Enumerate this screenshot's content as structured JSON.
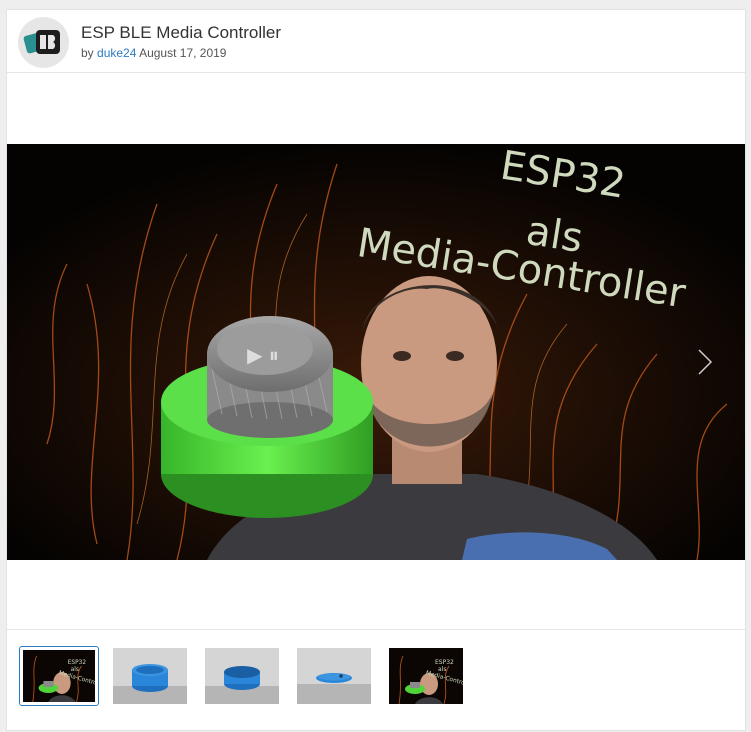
{
  "header": {
    "title": "ESP BLE Media Controller",
    "by_label": "by",
    "author": "duke24",
    "date": "August 17, 2019"
  },
  "slide": {
    "overlay_text": [
      "ESP32",
      "als",
      "Media-Controller"
    ],
    "button_glyphs": "▶ ⏸"
  },
  "thumbnails": [
    {
      "label": "video thumbnail",
      "active": true
    },
    {
      "label": "blue base render"
    },
    {
      "label": "blue base render angled"
    },
    {
      "label": "blue lid render"
    },
    {
      "label": "video thumbnail"
    }
  ],
  "colors": {
    "link": "#2b7bc0",
    "accent_green": "#4fd43a",
    "part_blue": "#2a86d8"
  }
}
